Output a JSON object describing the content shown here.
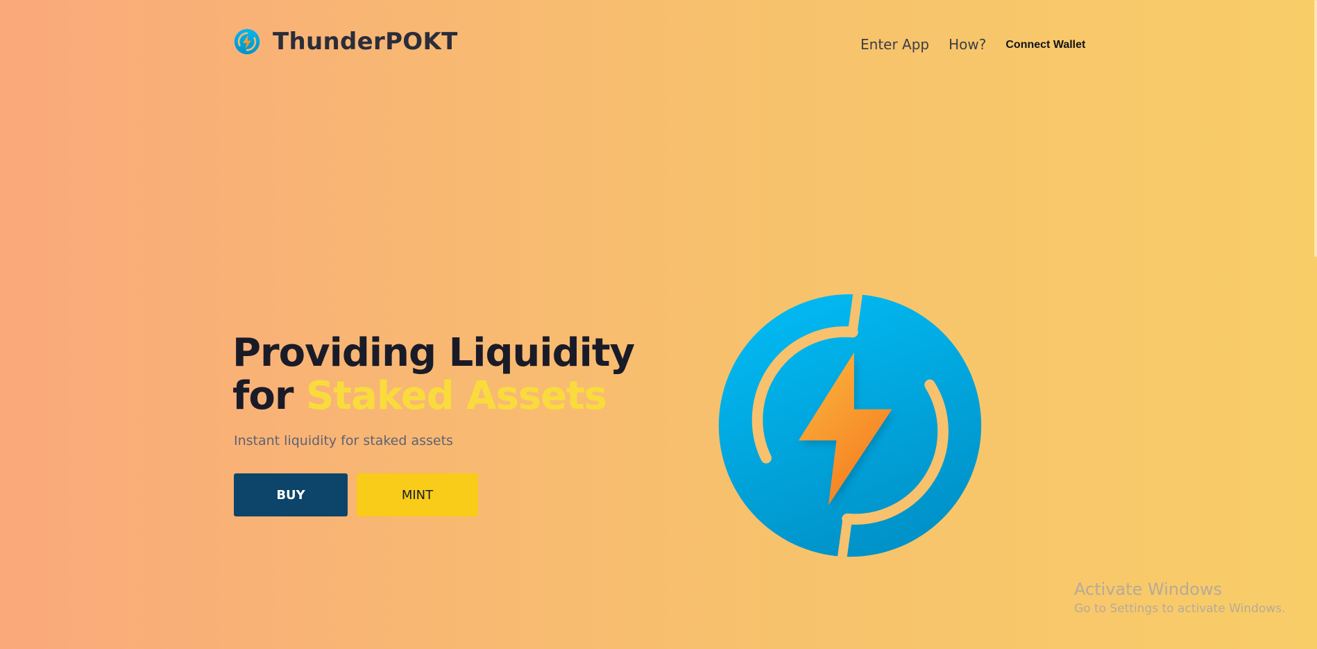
{
  "header": {
    "brand": "ThunderPOKT",
    "logo_icon": "thunderpokt-logo-icon",
    "nav": {
      "enter_app": "Enter App",
      "how": "How?",
      "connect_wallet": "Connect Wallet"
    }
  },
  "hero": {
    "title_line1": "Providing Liquidity",
    "title_line2_prefix": "for ",
    "title_line2_accent": "Staked Assets",
    "subtitle": "Instant liquidity for staked assets",
    "buy_label": "BUY",
    "mint_label": "MINT",
    "illustration_icon": "thunderpokt-logo-large"
  },
  "watermark": {
    "title": "Activate Windows",
    "subtitle": "Go to Settings to activate Windows."
  },
  "colors": {
    "accent_yellow": "#f9dc3c",
    "buy_button": "#0c4569",
    "mint_button": "#f8cc19",
    "logo_blue": "#00a8e0",
    "bolt_orange": "#f7931e"
  }
}
